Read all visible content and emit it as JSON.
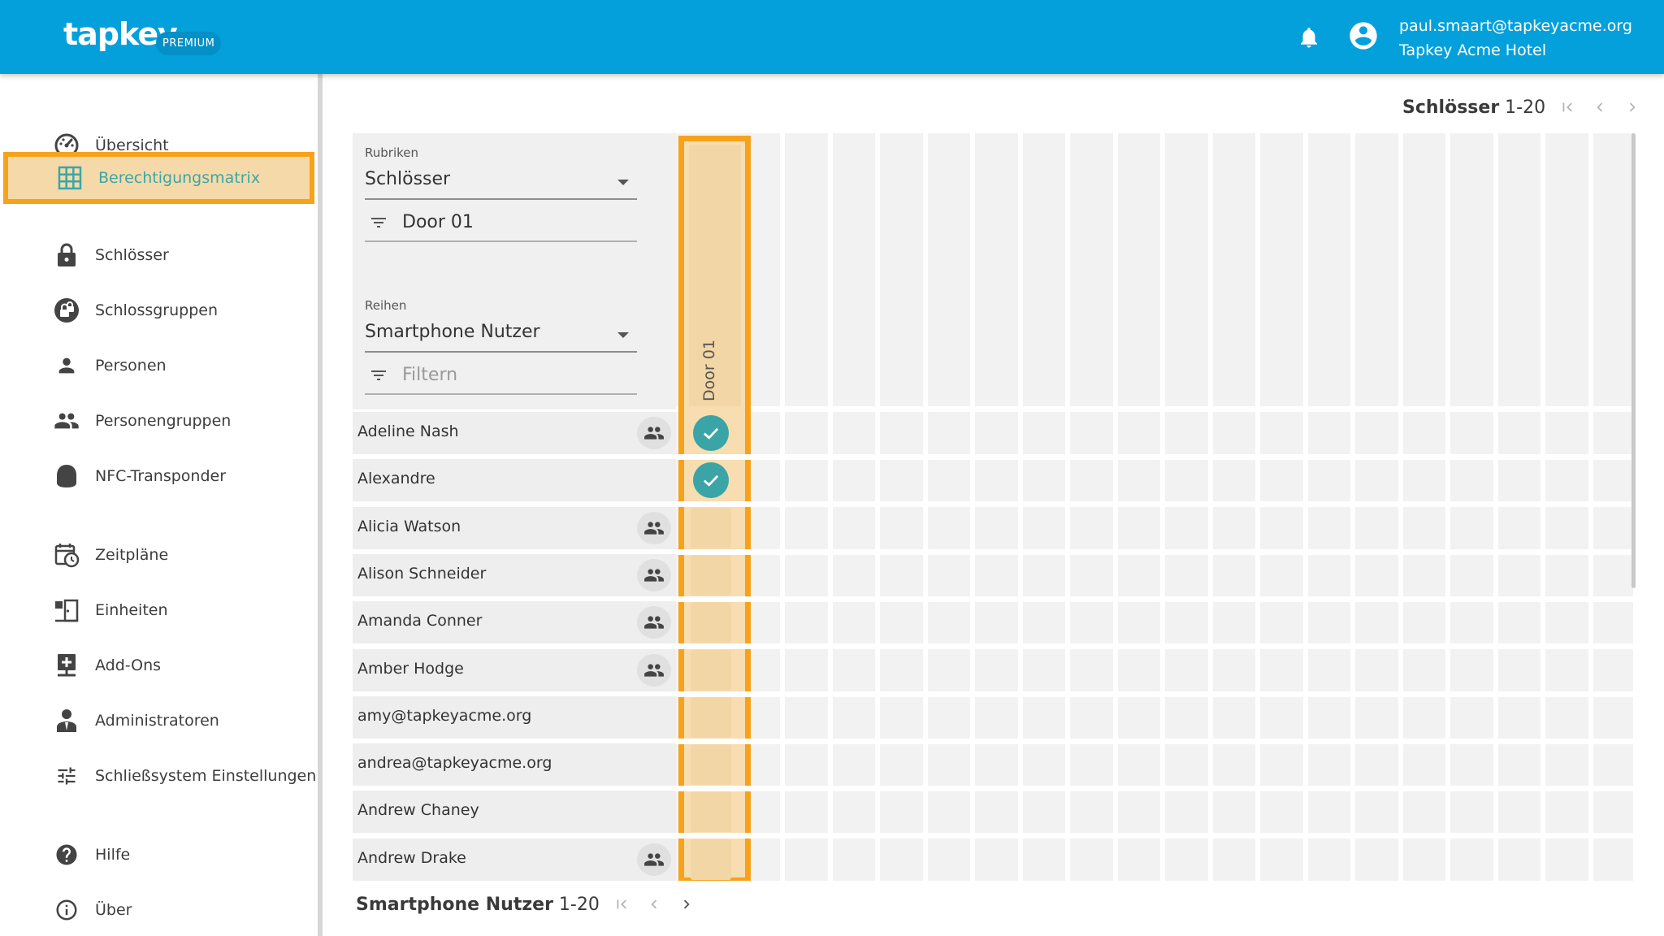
{
  "header": {
    "logo_text": "tapkey",
    "badge": "PREMIUM",
    "user_email": "paul.smaart@tapkeyacme.org",
    "org_name": "Tapkey Acme Hotel",
    "brand_color": "#03a0dc"
  },
  "sidebar": {
    "items": [
      {
        "label": "Übersicht",
        "icon": "dashboard-icon"
      },
      {
        "label": "Berechtigungsmatrix",
        "icon": "grid-icon",
        "active": true
      },
      {
        "label": "Schlösser",
        "icon": "lock-icon"
      },
      {
        "label": "Schlossgruppen",
        "icon": "lock-group-icon"
      },
      {
        "label": "Personen",
        "icon": "person-icon"
      },
      {
        "label": "Personengruppen",
        "icon": "people-icon"
      },
      {
        "label": "NFC-Transponder",
        "icon": "nfc-tag-icon"
      },
      {
        "label": "Zeitpläne",
        "icon": "calendar-clock-icon"
      },
      {
        "label": "Einheiten",
        "icon": "door-unit-icon"
      },
      {
        "label": "Add-Ons",
        "icon": "add-on-icon"
      },
      {
        "label": "Administratoren",
        "icon": "admin-icon"
      },
      {
        "label": "Schließsystem Einstellungen",
        "icon": "tune-icon"
      },
      {
        "label": "Hilfe",
        "icon": "help-icon"
      },
      {
        "label": "Über",
        "icon": "info-icon"
      }
    ]
  },
  "lock_pager": {
    "label": "Schlösser",
    "range": "1-20"
  },
  "filters": {
    "columns_label": "Rubriken",
    "columns_value": "Schlösser",
    "columns_filter": "Door 01",
    "rows_label": "Reihen",
    "rows_value": "Smartphone Nutzer",
    "rows_filter_placeholder": "Filtern"
  },
  "matrix": {
    "column": "Door 01",
    "rows": [
      {
        "name": "Adeline Nash",
        "group": true,
        "access": true
      },
      {
        "name": "Alexandre",
        "group": false,
        "access": true
      },
      {
        "name": "Alicia Watson",
        "group": true,
        "access": false
      },
      {
        "name": "Alison Schneider",
        "group": true,
        "access": false
      },
      {
        "name": "Amanda Conner",
        "group": true,
        "access": false
      },
      {
        "name": "Amber Hodge",
        "group": true,
        "access": false
      },
      {
        "name": "amy@tapkeyacme.org",
        "group": false,
        "access": false
      },
      {
        "name": "andrea@tapkeyacme.org",
        "group": false,
        "access": false
      },
      {
        "name": "Andrew Chaney",
        "group": false,
        "access": false
      },
      {
        "name": "Andrew Drake",
        "group": true,
        "access": false
      }
    ],
    "highlight_color": "#f7a21b",
    "check_color": "#3aa4a6"
  },
  "user_pager": {
    "label": "Smartphone Nutzer",
    "range": "1-20"
  }
}
